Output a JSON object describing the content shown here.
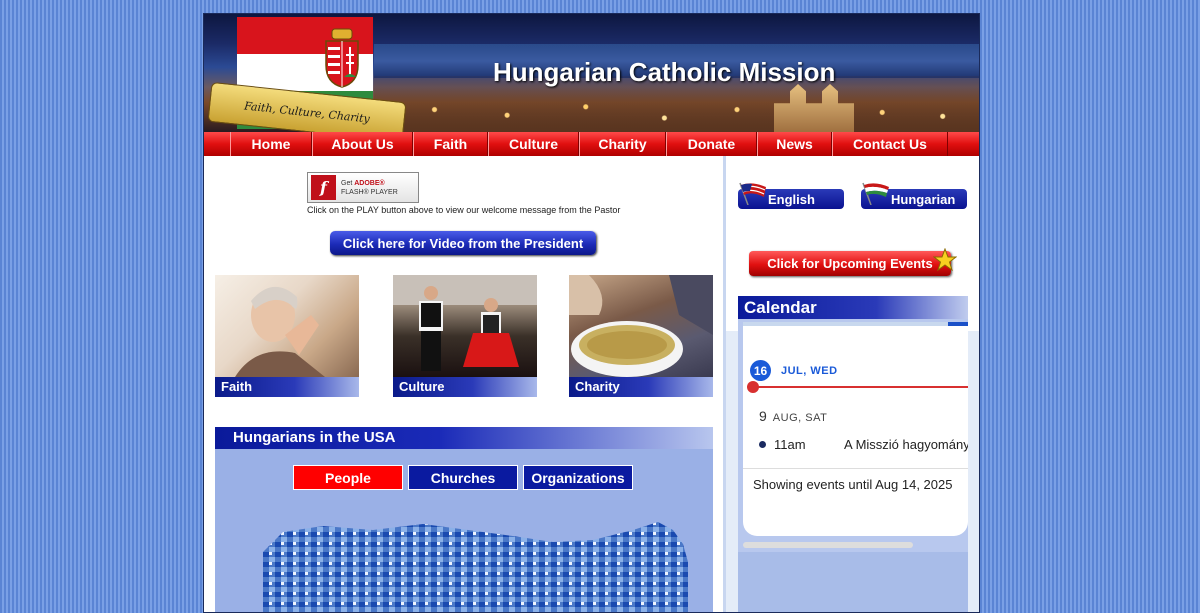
{
  "site": {
    "title": "Hungarian Catholic Mission",
    "ribbon_text": "Faith, Culture, Charity"
  },
  "nav": {
    "items": [
      {
        "label": "Home"
      },
      {
        "label": "About Us"
      },
      {
        "label": "Faith"
      },
      {
        "label": "Culture"
      },
      {
        "label": "Charity"
      },
      {
        "label": "Donate"
      },
      {
        "label": "News"
      },
      {
        "label": "Contact Us"
      }
    ]
  },
  "flash": {
    "line1": "Get",
    "brand": "ADOBE®",
    "line2": "FLASH® PLAYER",
    "note": "Click on the PLAY button above to view our welcome message from the Pastor"
  },
  "president_button": "Click here for Video from the President",
  "tiles": [
    {
      "caption": "Faith"
    },
    {
      "caption": "Culture"
    },
    {
      "caption": "Charity"
    }
  ],
  "usa": {
    "header": "Hungarians in the USA",
    "tabs": [
      {
        "label": "People"
      },
      {
        "label": "Churches"
      },
      {
        "label": "Organizations"
      }
    ]
  },
  "languages": {
    "english": "English",
    "hungarian": "Hungarian"
  },
  "events_button": "Click for Upcoming Events",
  "calendar": {
    "header": "Calendar",
    "day1_num": "16",
    "day1_label": "JUL, WED",
    "day2_num": "9",
    "day2_label": "AUG, SAT",
    "event_time": "11am",
    "event_title": "A Misszió hagyomány",
    "showing": "Showing events until Aug 14, 2025"
  },
  "colors": {
    "nav_red": "#e01010",
    "navy": "#0a1aa0",
    "people_red": "#ff0000"
  }
}
